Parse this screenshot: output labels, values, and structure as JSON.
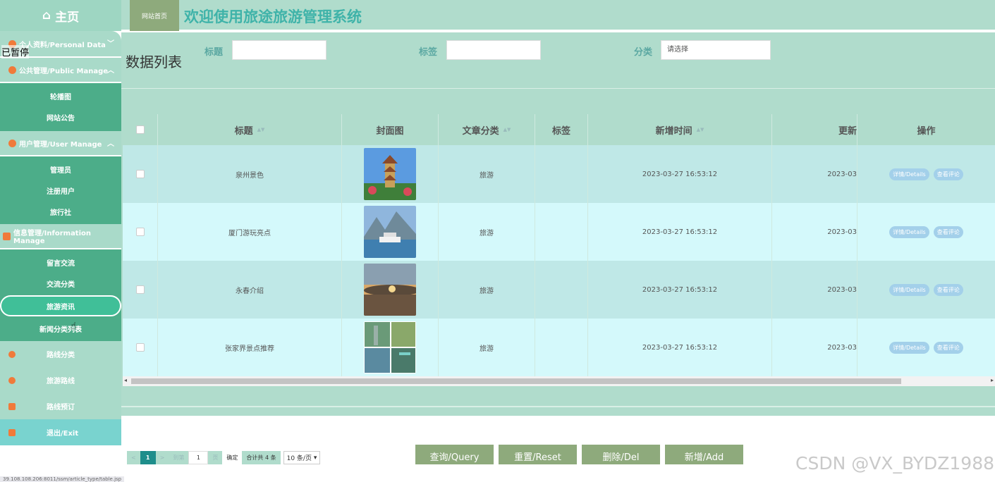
{
  "sidebar": {
    "home_label": "主页",
    "personal": "个人资料/Personal Data",
    "public_manage": "公共管理/Public Manage",
    "public_items": [
      "轮播图",
      "网站公告"
    ],
    "user_manage": "用户管理/User Manage",
    "user_items": [
      "管理员",
      "注册用户",
      "旅行社"
    ],
    "info_manage": "信息管理/Information Manage",
    "info_items": [
      "留言交流",
      "交流分类",
      "旅游资讯",
      "新闻分类列表"
    ],
    "route_category": "路线分类",
    "travel_route": "旅游路线",
    "route_booking": "路线预订",
    "exit": "退出/Exit"
  },
  "overlay": "已暂停",
  "header": {
    "site_home": "网站首页",
    "title": "欢迎使用旅途旅游管理系统"
  },
  "filters": {
    "list_title": "数据列表",
    "title_label": "标题",
    "title_value": "",
    "tag_label": "标签",
    "tag_value": "",
    "category_label": "分类",
    "category_placeholder": "请选择"
  },
  "table": {
    "columns": [
      "标题",
      "封面图",
      "文章分类",
      "标签",
      "新增时间",
      "更新",
      "操作"
    ],
    "rows": [
      {
        "title": "泉州景色",
        "category": "旅游",
        "tag": "",
        "created": "2023-03-27 16:53:12",
        "updated": "2023-03"
      },
      {
        "title": "厦门游玩亮点",
        "category": "旅游",
        "tag": "",
        "created": "2023-03-27 16:53:12",
        "updated": "2023-03"
      },
      {
        "title": "永春介绍",
        "category": "旅游",
        "tag": "",
        "created": "2023-03-27 16:53:12",
        "updated": "2023-03"
      },
      {
        "title": "张家界景点推荐",
        "category": "旅游",
        "tag": "",
        "created": "2023-03-27 16:53:12",
        "updated": "2023-03"
      }
    ],
    "row_actions": [
      "详情/Details",
      "查看评论"
    ]
  },
  "pagination": {
    "prev": "<",
    "current_page": "1",
    "next": ">",
    "goto_label": "到第",
    "goto_value": "1",
    "page_unit": "页",
    "confirm": "确定",
    "total": "合计共 4 条",
    "page_size": "10 条/页"
  },
  "actions": {
    "query": "查询/Query",
    "reset": "重置/Reset",
    "delete": "删除/Del",
    "add": "新增/Add"
  },
  "watermark": "CSDN @VX_BYDZ1988",
  "status_url": "39.108.108.206:8011/ssm/article_type/table.jsp",
  "colors": {
    "sidebar_green": "#4cad89",
    "header_mint": "#b0dccc",
    "button_olive": "#8eaa7c",
    "title_teal": "#3fb3a9"
  }
}
